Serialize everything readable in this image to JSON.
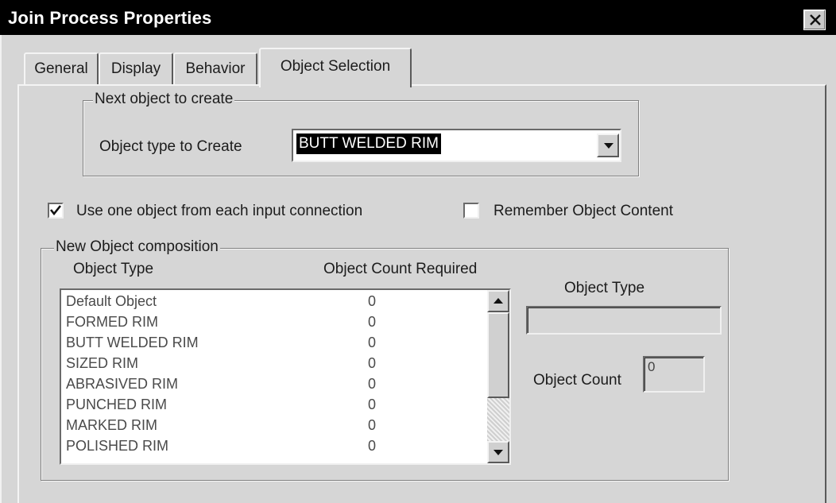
{
  "window": {
    "title": "Join Process Properties"
  },
  "tabs": [
    {
      "label": "General"
    },
    {
      "label": "Display"
    },
    {
      "label": "Behavior"
    },
    {
      "label": "Object Selection",
      "active": true
    }
  ],
  "next_object": {
    "group_label": "Next object to create",
    "type_label": "Object type to Create",
    "selected_value": "BUTT WELDED RIM"
  },
  "options": {
    "use_one_object": {
      "label": "Use one object from each input connection",
      "checked": true
    },
    "remember_content": {
      "label": "Remember Object Content",
      "checked": false
    }
  },
  "composition": {
    "group_label": "New Object composition",
    "col_type": "Object Type",
    "col_count": "Object Count Required",
    "rows": [
      {
        "type": "Default Object",
        "count": "0"
      },
      {
        "type": "FORMED RIM",
        "count": "0"
      },
      {
        "type": "BUTT WELDED RIM",
        "count": "0"
      },
      {
        "type": "SIZED RIM",
        "count": "0"
      },
      {
        "type": "ABRASIVED RIM",
        "count": "0"
      },
      {
        "type": "PUNCHED RIM",
        "count": "0"
      },
      {
        "type": "MARKED RIM",
        "count": "0"
      },
      {
        "type": "POLISHED RIM",
        "count": "0"
      }
    ],
    "detail_type_label": "Object Type",
    "detail_type_value": "",
    "detail_count_label": "Object Count",
    "detail_count_value": "0"
  },
  "icons": {
    "close": "close-icon",
    "dropdown": "chevron-down-icon",
    "check": "check-icon",
    "scroll_up": "arrow-up-icon",
    "scroll_down": "arrow-down-icon"
  }
}
